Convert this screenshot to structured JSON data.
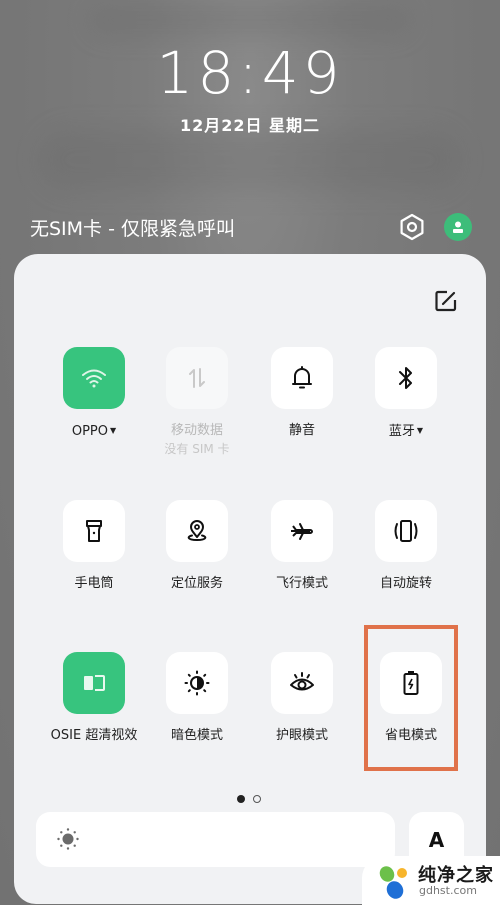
{
  "lockscreen": {
    "time": "18:49",
    "date": "12月22日  星期二",
    "sim_status": "无SIM卡 - 仅限紧急呼叫"
  },
  "header_actions": {
    "settings_icon": "settings-hexagon-icon",
    "user_icon": "user-avatar-icon",
    "edit_icon": "edit-icon"
  },
  "colors": {
    "active_tile": "#37c47e",
    "highlight_border": "#e0724a",
    "panel_bg": "#f1f2f4"
  },
  "tiles": [
    {
      "label": "OPPO",
      "icon": "wifi-icon",
      "state": "on",
      "has_dropdown": true
    },
    {
      "label": "移动数据",
      "sub": "没有 SIM 卡",
      "icon": "mobile-data-icon",
      "state": "disabled"
    },
    {
      "label": "静音",
      "icon": "bell-icon",
      "state": "off"
    },
    {
      "label": "蓝牙",
      "icon": "bluetooth-icon",
      "state": "off",
      "has_dropdown": true
    },
    {
      "label": "手电筒",
      "icon": "flashlight-icon",
      "state": "off"
    },
    {
      "label": "定位服务",
      "icon": "location-icon",
      "state": "off"
    },
    {
      "label": "飞行模式",
      "icon": "airplane-icon",
      "state": "off"
    },
    {
      "label": "自动旋转",
      "icon": "auto-rotate-icon",
      "state": "off"
    },
    {
      "label": "OSIE 超清视效",
      "icon": "osie-display-icon",
      "state": "on"
    },
    {
      "label": "暗色模式",
      "icon": "dark-mode-icon",
      "state": "off"
    },
    {
      "label": "护眼模式",
      "icon": "eye-comfort-icon",
      "state": "off"
    },
    {
      "label": "省电模式",
      "icon": "battery-saver-icon",
      "state": "off",
      "highlighted": true
    }
  ],
  "pagination": {
    "current": 1,
    "total": 2
  },
  "brightness": {
    "icon": "brightness-sun-icon",
    "auto_label": "A"
  },
  "watermark": {
    "cn": "纯净之家",
    "en": "gdhst.com"
  }
}
